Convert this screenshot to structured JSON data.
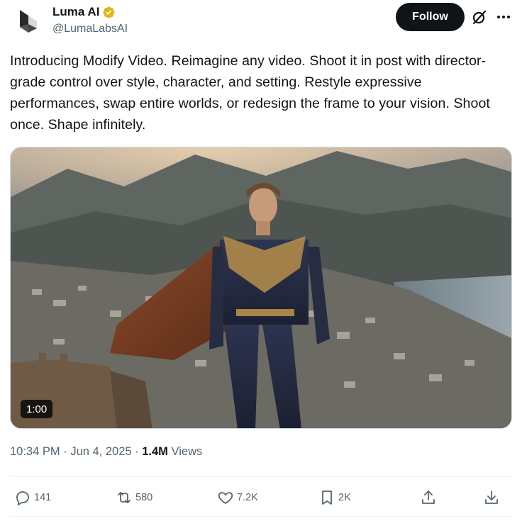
{
  "author": {
    "name": "Luma AI",
    "handle": "@LumaLabsAI",
    "verified_icon": "verified-badge-gold",
    "avatar_icon": "luma-logo"
  },
  "header": {
    "follow_label": "Follow",
    "grok_icon": "grok-icon",
    "more_icon": "more-icon"
  },
  "tweet": {
    "text": "Introducing Modify Video. Reimagine any video. Shoot it in post with director-grade control over style, character, and setting. Restyle expressive performances, swap entire worlds, or redesign the frame to your vision. Shoot once. Shape infinitely."
  },
  "media": {
    "type": "video",
    "duration": "1:00"
  },
  "meta": {
    "time": "10:34 PM",
    "date": "Jun 4, 2025",
    "views_count": "1.4M",
    "views_label": "Views",
    "separator": "·"
  },
  "actions": {
    "replies": "141",
    "reposts": "580",
    "likes": "7.2K",
    "bookmarks": "2K"
  },
  "colors": {
    "text_primary": "#0f1419",
    "text_secondary": "#536471",
    "follow_bg": "#0f1419",
    "verified_gold": "#e2b719"
  }
}
